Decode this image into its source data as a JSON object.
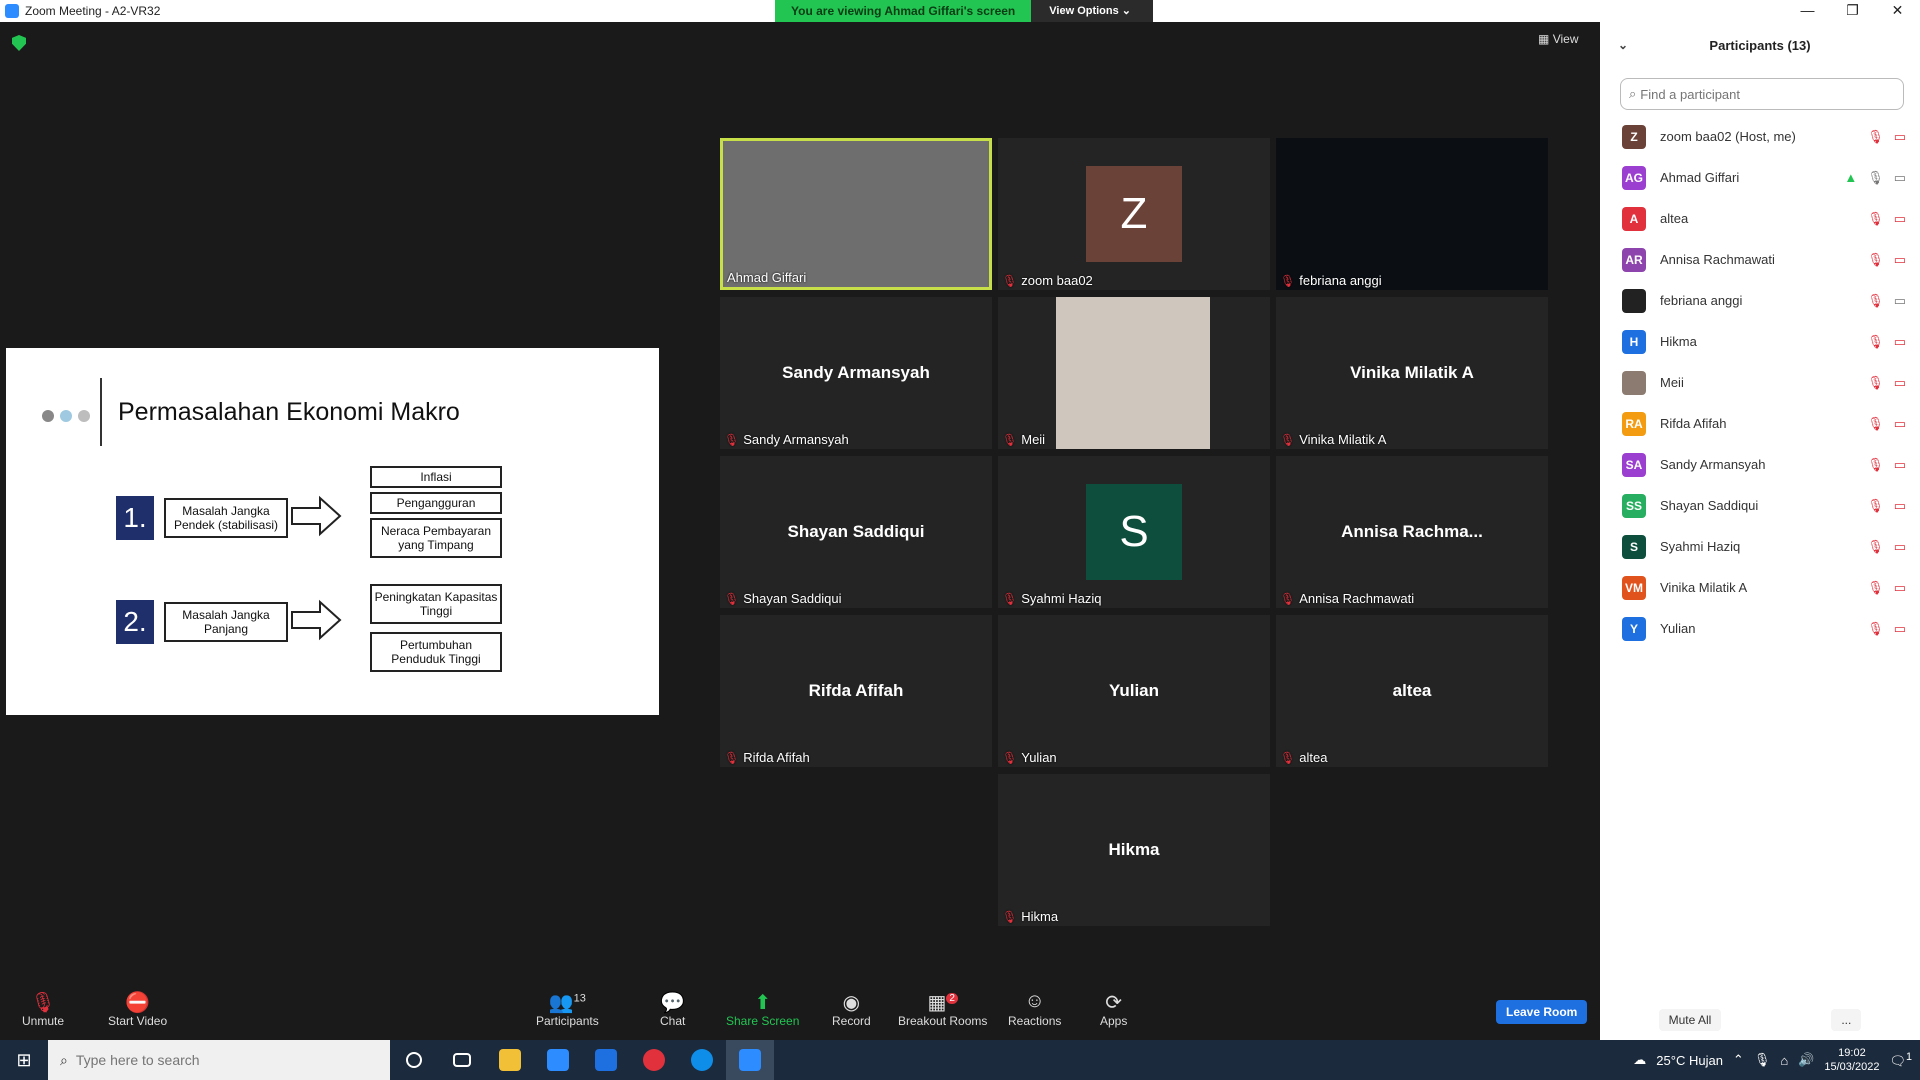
{
  "window": {
    "title": "Zoom Meeting - A2-VR32",
    "minimize": "—",
    "restore": "❐",
    "close": "✕"
  },
  "share_bar": {
    "viewing_text": "You are viewing Ahmad Giffari's screen",
    "view_options": "View Options ⌄"
  },
  "view_button": "View",
  "slide": {
    "title": "Permasalahan Ekonomi Makro",
    "item1_number": "1.",
    "item1_label": "Masalah Jangka Pendek (stabilisasi)",
    "item1_outcomes": [
      "Inflasi",
      "Pengangguran",
      "Neraca Pembayaran yang Timpang"
    ],
    "item2_number": "2.",
    "item2_label": "Masalah Jangka Panjang",
    "item2_outcomes": [
      "Peningkatan Kapasitas Tinggi",
      "Pertumbuhan Penduduk Tinggi"
    ],
    "dot_colors": [
      "#888888",
      "#9ec9e0",
      "#bdbdbd"
    ]
  },
  "tiles": [
    {
      "label": "Ahmad Giffari",
      "type": "video"
    },
    {
      "label": "zoom baa02",
      "type": "avatar",
      "letter": "Z",
      "color": "#6b4238"
    },
    {
      "label": "febriana anggi",
      "type": "blank"
    },
    {
      "label": "Sandy Armansyah",
      "big": "Sandy Armansyah",
      "type": "name"
    },
    {
      "label": "Meii",
      "type": "video"
    },
    {
      "label": "Vinika Milatik A",
      "big": "Vinika Milatik A",
      "type": "name"
    },
    {
      "label": "Shayan Saddiqui",
      "big": "Shayan Saddiqui",
      "type": "name"
    },
    {
      "label": "Syahmi Haziq",
      "type": "avatar",
      "letter": "S",
      "color": "#0d4f3c"
    },
    {
      "label": "Annisa Rachmawati",
      "big": "Annisa  Rachma...",
      "type": "name"
    },
    {
      "label": "Rifda Afifah",
      "big": "Rifda Afifah",
      "type": "name"
    },
    {
      "label": "Yulian",
      "big": "Yulian",
      "type": "name"
    },
    {
      "label": "altea",
      "big": "altea",
      "type": "name"
    },
    {
      "label": "Hikma",
      "big": "Hikma",
      "type": "name"
    }
  ],
  "participants_panel": {
    "title": "Participants (13)",
    "search_placeholder": "Find a participant",
    "list": [
      {
        "initials": "Z",
        "name": "zoom baa02 (Host, me)",
        "color": "#6b4238"
      },
      {
        "initials": "AG",
        "name": "Ahmad Giffari",
        "color": "#9b3fd1"
      },
      {
        "initials": "A",
        "name": "altea",
        "color": "#e0313d"
      },
      {
        "initials": "AR",
        "name": "Annisa Rachmawati",
        "color": "#8e44ad"
      },
      {
        "initials": "",
        "name": "febriana anggi",
        "color": "#222222"
      },
      {
        "initials": "H",
        "name": "Hikma",
        "color": "#1e6fe0"
      },
      {
        "initials": "",
        "name": "Meii",
        "color": "#8c7b70"
      },
      {
        "initials": "RA",
        "name": "Rifda Afifah",
        "color": "#f39c12"
      },
      {
        "initials": "SA",
        "name": "Sandy Armansyah",
        "color": "#9b3fd1"
      },
      {
        "initials": "SS",
        "name": "Shayan Saddiqui",
        "color": "#27ae60"
      },
      {
        "initials": "S",
        "name": "Syahmi Haziq",
        "color": "#0d4f3c"
      },
      {
        "initials": "VM",
        "name": "Vinika Milatik A",
        "color": "#e0531d"
      },
      {
        "initials": "Y",
        "name": "Yulian",
        "color": "#1e6fe0"
      }
    ],
    "mute_all": "Mute All",
    "more": "..."
  },
  "toolbar": {
    "unmute": "Unmute",
    "start_video": "Start Video",
    "participants": "Participants",
    "participants_count": "13",
    "chat": "Chat",
    "share_screen": "Share Screen",
    "record": "Record",
    "breakout_rooms": "Breakout Rooms",
    "breakout_badge": "2",
    "reactions": "Reactions",
    "apps": "Apps",
    "leave_room": "Leave Room"
  },
  "taskbar": {
    "search_placeholder": "Type here to search",
    "weather": "25°C  Hujan",
    "time": "19:02",
    "date": "15/03/2022",
    "notifications": "1"
  }
}
